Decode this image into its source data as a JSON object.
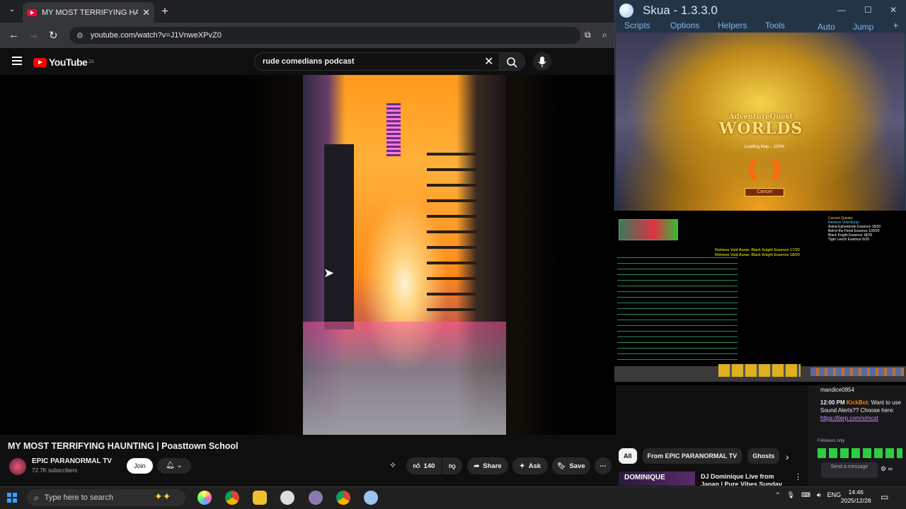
{
  "browser": {
    "tab_title": "MY MOST TERRIFYING HAU",
    "url": "youtube.com/watch?v=J1VnweXPvZ0"
  },
  "youtube": {
    "logo_text": "YouTube",
    "region": "ZA",
    "search_value": "rude comedians podcast",
    "video_title": "MY MOST TERRIFYING HAUNTING | Poasttown School",
    "channel_name": "EPIC PARANORMAL TV",
    "subscribers": "72.7K subscribers",
    "join_label": "Join",
    "like_count": "140",
    "share_label": "Share",
    "ask_label": "Ask",
    "save_label": "Save",
    "chips": [
      "All",
      "From EPIC PARANORMAL TV",
      "Ghosts"
    ],
    "rec_thumb_text": "DOMINIQUE",
    "rec_title": "DJ Dominique Live from Japan | Pure Vibes Sunday"
  },
  "skua": {
    "title": "Skua - 1.3.3.0",
    "menu": [
      "Scripts",
      "Options",
      "Helpers",
      "Tools"
    ],
    "menu_right": [
      "Auto",
      "Jump"
    ],
    "game_logo_top": "AdventureQuest",
    "game_logo_bottom": "WORLDS",
    "loading_text": "Loading Map... 100%",
    "cancel_label": "Cancel",
    "quest_header": "Current Quests:",
    "quest_name": "Retrieve Void Auras",
    "quest_items": [
      "Astral Ephemerite Essence 18/20",
      "Belrot the Fiend Essence 100/20",
      "Black Knight Essence 18/20",
      "Tiger Leech Essence 6/20"
    ],
    "yellow_msgs": [
      "Retrieve Void Auras: Black Knight Essence 17/20",
      "Retrieve Void Auras: Black Knight Essence 18/20"
    ]
  },
  "chat": {
    "username": "mandice0854",
    "time": "12:00 PM",
    "bot": "KickBot",
    "message": "Want to use Sound Alerts?? Choose here:",
    "link": "https://lierp.com/x/mcst",
    "followers_only": "Followers only",
    "send_placeholder": "Send a message"
  },
  "taskbar": {
    "search_placeholder": "Type here to search",
    "language": "ENG",
    "time": "14:46",
    "date": "2025/12/28"
  }
}
